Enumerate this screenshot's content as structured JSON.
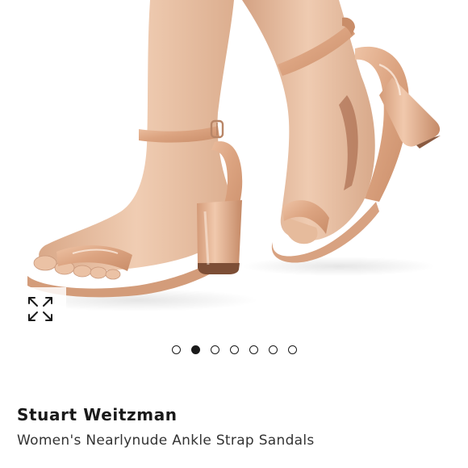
{
  "product": {
    "brand": "Stuart Weitzman",
    "title": "Women's Nearlynude Ankle Strap Sandals"
  },
  "gallery": {
    "image_subject": "nude-patent-block-heel-ankle-strap-sandals",
    "image_count": 7,
    "active_index": 2,
    "expand_icon": "expand-arrows-icon"
  },
  "colors": {
    "brand_text": "#1a1a1a",
    "title_text": "#333333",
    "dot_active": "#1a1a1a",
    "skin": "#e9c3a6",
    "shoe_patent": "#e2b08f"
  }
}
